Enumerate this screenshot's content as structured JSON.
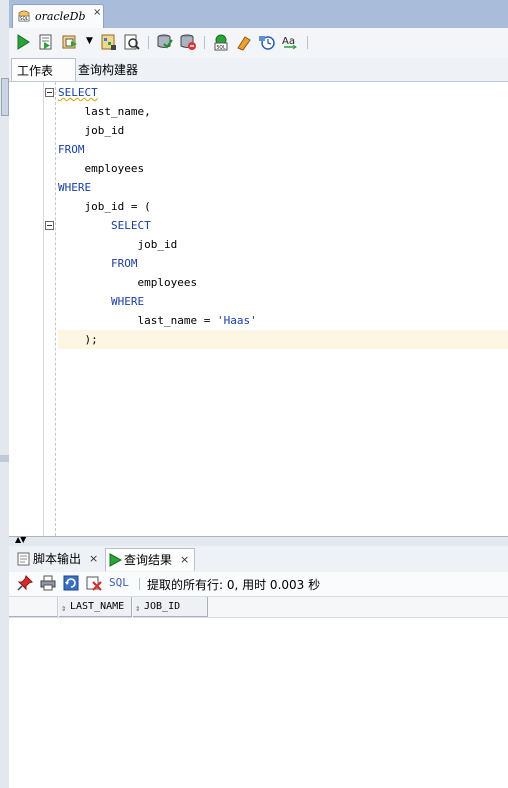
{
  "window": {
    "tab_title": "oracleDb",
    "tab_close": "×",
    "tab_icon": "sql-worksheet-icon"
  },
  "toolbar": {
    "buttons": [
      "run-statement-icon",
      "run-script-icon",
      "autotrace-icon",
      "dropdown-icon",
      "explain-plan-icon",
      "sql-tuning-icon",
      "commit-icon",
      "rollback-icon",
      "unshared-sql-icon",
      "clear-icon",
      "history-icon",
      "format-icon"
    ]
  },
  "subtabs": {
    "worksheet": "工作表",
    "query_builder": "查询构建器"
  },
  "editor": {
    "lines": [
      {
        "text": "SELECT",
        "type": "kw"
      },
      {
        "text": "    last_name,",
        "type": "plain"
      },
      {
        "text": "    job_id",
        "type": "plain"
      },
      {
        "text": "FROM",
        "type": "kw"
      },
      {
        "text": "    employees",
        "type": "plain"
      },
      {
        "text": "WHERE",
        "type": "kw"
      },
      {
        "text": "    job_id = (",
        "type": "plain"
      },
      {
        "text": "        SELECT",
        "type": "kw"
      },
      {
        "text": "            job_id",
        "type": "plain"
      },
      {
        "text": "        FROM",
        "type": "kw"
      },
      {
        "text": "            employees",
        "type": "plain"
      },
      {
        "text": "        WHERE",
        "type": "kw"
      },
      {
        "text": "            last_name = ",
        "type": "plain",
        "string": "'Haas'"
      },
      {
        "text": "    );",
        "type": "plain"
      }
    ]
  },
  "splitter": {
    "arrows": "▲▼"
  },
  "results": {
    "tabs": [
      {
        "label": "脚本输出",
        "close": "×",
        "icon": "script-output-icon"
      },
      {
        "label": "查询结果",
        "close": "×",
        "icon": "query-result-icon"
      }
    ],
    "toolbar": {
      "sql_label": "SQL",
      "separator": "|",
      "status": "提取的所有行: 0, 用时 0.003 秒"
    },
    "grid": {
      "columns": [
        "LAST_NAME",
        "JOB_ID"
      ],
      "sort_glyph": "⇕",
      "rows": []
    }
  }
}
